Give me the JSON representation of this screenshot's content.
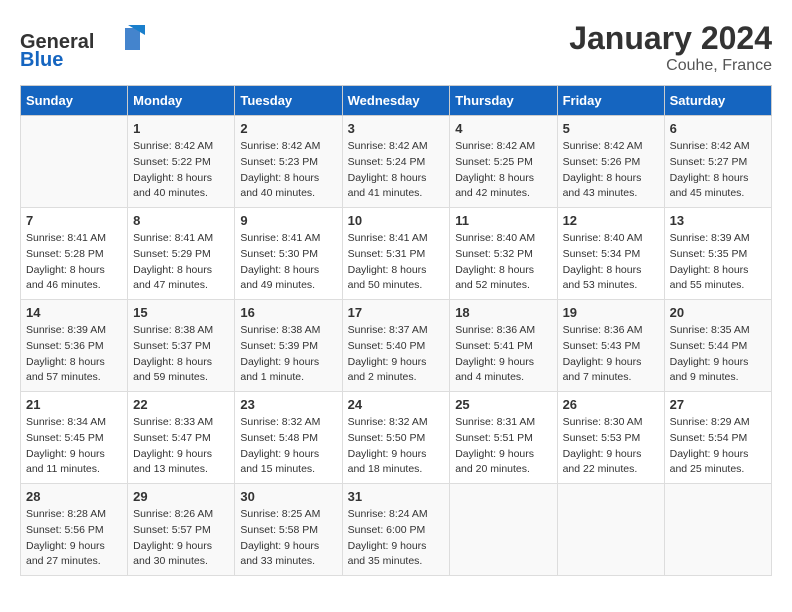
{
  "header": {
    "logo_general": "General",
    "logo_blue": "Blue",
    "month_year": "January 2024",
    "location": "Couhe, France"
  },
  "days_of_week": [
    "Sunday",
    "Monday",
    "Tuesday",
    "Wednesday",
    "Thursday",
    "Friday",
    "Saturday"
  ],
  "weeks": [
    [
      {
        "day": "",
        "sunrise": "",
        "sunset": "",
        "daylight": ""
      },
      {
        "day": "1",
        "sunrise": "Sunrise: 8:42 AM",
        "sunset": "Sunset: 5:22 PM",
        "daylight": "Daylight: 8 hours and 40 minutes."
      },
      {
        "day": "2",
        "sunrise": "Sunrise: 8:42 AM",
        "sunset": "Sunset: 5:23 PM",
        "daylight": "Daylight: 8 hours and 40 minutes."
      },
      {
        "day": "3",
        "sunrise": "Sunrise: 8:42 AM",
        "sunset": "Sunset: 5:24 PM",
        "daylight": "Daylight: 8 hours and 41 minutes."
      },
      {
        "day": "4",
        "sunrise": "Sunrise: 8:42 AM",
        "sunset": "Sunset: 5:25 PM",
        "daylight": "Daylight: 8 hours and 42 minutes."
      },
      {
        "day": "5",
        "sunrise": "Sunrise: 8:42 AM",
        "sunset": "Sunset: 5:26 PM",
        "daylight": "Daylight: 8 hours and 43 minutes."
      },
      {
        "day": "6",
        "sunrise": "Sunrise: 8:42 AM",
        "sunset": "Sunset: 5:27 PM",
        "daylight": "Daylight: 8 hours and 45 minutes."
      }
    ],
    [
      {
        "day": "7",
        "sunrise": "Sunrise: 8:41 AM",
        "sunset": "Sunset: 5:28 PM",
        "daylight": "Daylight: 8 hours and 46 minutes."
      },
      {
        "day": "8",
        "sunrise": "Sunrise: 8:41 AM",
        "sunset": "Sunset: 5:29 PM",
        "daylight": "Daylight: 8 hours and 47 minutes."
      },
      {
        "day": "9",
        "sunrise": "Sunrise: 8:41 AM",
        "sunset": "Sunset: 5:30 PM",
        "daylight": "Daylight: 8 hours and 49 minutes."
      },
      {
        "day": "10",
        "sunrise": "Sunrise: 8:41 AM",
        "sunset": "Sunset: 5:31 PM",
        "daylight": "Daylight: 8 hours and 50 minutes."
      },
      {
        "day": "11",
        "sunrise": "Sunrise: 8:40 AM",
        "sunset": "Sunset: 5:32 PM",
        "daylight": "Daylight: 8 hours and 52 minutes."
      },
      {
        "day": "12",
        "sunrise": "Sunrise: 8:40 AM",
        "sunset": "Sunset: 5:34 PM",
        "daylight": "Daylight: 8 hours and 53 minutes."
      },
      {
        "day": "13",
        "sunrise": "Sunrise: 8:39 AM",
        "sunset": "Sunset: 5:35 PM",
        "daylight": "Daylight: 8 hours and 55 minutes."
      }
    ],
    [
      {
        "day": "14",
        "sunrise": "Sunrise: 8:39 AM",
        "sunset": "Sunset: 5:36 PM",
        "daylight": "Daylight: 8 hours and 57 minutes."
      },
      {
        "day": "15",
        "sunrise": "Sunrise: 8:38 AM",
        "sunset": "Sunset: 5:37 PM",
        "daylight": "Daylight: 8 hours and 59 minutes."
      },
      {
        "day": "16",
        "sunrise": "Sunrise: 8:38 AM",
        "sunset": "Sunset: 5:39 PM",
        "daylight": "Daylight: 9 hours and 1 minute."
      },
      {
        "day": "17",
        "sunrise": "Sunrise: 8:37 AM",
        "sunset": "Sunset: 5:40 PM",
        "daylight": "Daylight: 9 hours and 2 minutes."
      },
      {
        "day": "18",
        "sunrise": "Sunrise: 8:36 AM",
        "sunset": "Sunset: 5:41 PM",
        "daylight": "Daylight: 9 hours and 4 minutes."
      },
      {
        "day": "19",
        "sunrise": "Sunrise: 8:36 AM",
        "sunset": "Sunset: 5:43 PM",
        "daylight": "Daylight: 9 hours and 7 minutes."
      },
      {
        "day": "20",
        "sunrise": "Sunrise: 8:35 AM",
        "sunset": "Sunset: 5:44 PM",
        "daylight": "Daylight: 9 hours and 9 minutes."
      }
    ],
    [
      {
        "day": "21",
        "sunrise": "Sunrise: 8:34 AM",
        "sunset": "Sunset: 5:45 PM",
        "daylight": "Daylight: 9 hours and 11 minutes."
      },
      {
        "day": "22",
        "sunrise": "Sunrise: 8:33 AM",
        "sunset": "Sunset: 5:47 PM",
        "daylight": "Daylight: 9 hours and 13 minutes."
      },
      {
        "day": "23",
        "sunrise": "Sunrise: 8:32 AM",
        "sunset": "Sunset: 5:48 PM",
        "daylight": "Daylight: 9 hours and 15 minutes."
      },
      {
        "day": "24",
        "sunrise": "Sunrise: 8:32 AM",
        "sunset": "Sunset: 5:50 PM",
        "daylight": "Daylight: 9 hours and 18 minutes."
      },
      {
        "day": "25",
        "sunrise": "Sunrise: 8:31 AM",
        "sunset": "Sunset: 5:51 PM",
        "daylight": "Daylight: 9 hours and 20 minutes."
      },
      {
        "day": "26",
        "sunrise": "Sunrise: 8:30 AM",
        "sunset": "Sunset: 5:53 PM",
        "daylight": "Daylight: 9 hours and 22 minutes."
      },
      {
        "day": "27",
        "sunrise": "Sunrise: 8:29 AM",
        "sunset": "Sunset: 5:54 PM",
        "daylight": "Daylight: 9 hours and 25 minutes."
      }
    ],
    [
      {
        "day": "28",
        "sunrise": "Sunrise: 8:28 AM",
        "sunset": "Sunset: 5:56 PM",
        "daylight": "Daylight: 9 hours and 27 minutes."
      },
      {
        "day": "29",
        "sunrise": "Sunrise: 8:26 AM",
        "sunset": "Sunset: 5:57 PM",
        "daylight": "Daylight: 9 hours and 30 minutes."
      },
      {
        "day": "30",
        "sunrise": "Sunrise: 8:25 AM",
        "sunset": "Sunset: 5:58 PM",
        "daylight": "Daylight: 9 hours and 33 minutes."
      },
      {
        "day": "31",
        "sunrise": "Sunrise: 8:24 AM",
        "sunset": "Sunset: 6:00 PM",
        "daylight": "Daylight: 9 hours and 35 minutes."
      },
      {
        "day": "",
        "sunrise": "",
        "sunset": "",
        "daylight": ""
      },
      {
        "day": "",
        "sunrise": "",
        "sunset": "",
        "daylight": ""
      },
      {
        "day": "",
        "sunrise": "",
        "sunset": "",
        "daylight": ""
      }
    ]
  ]
}
